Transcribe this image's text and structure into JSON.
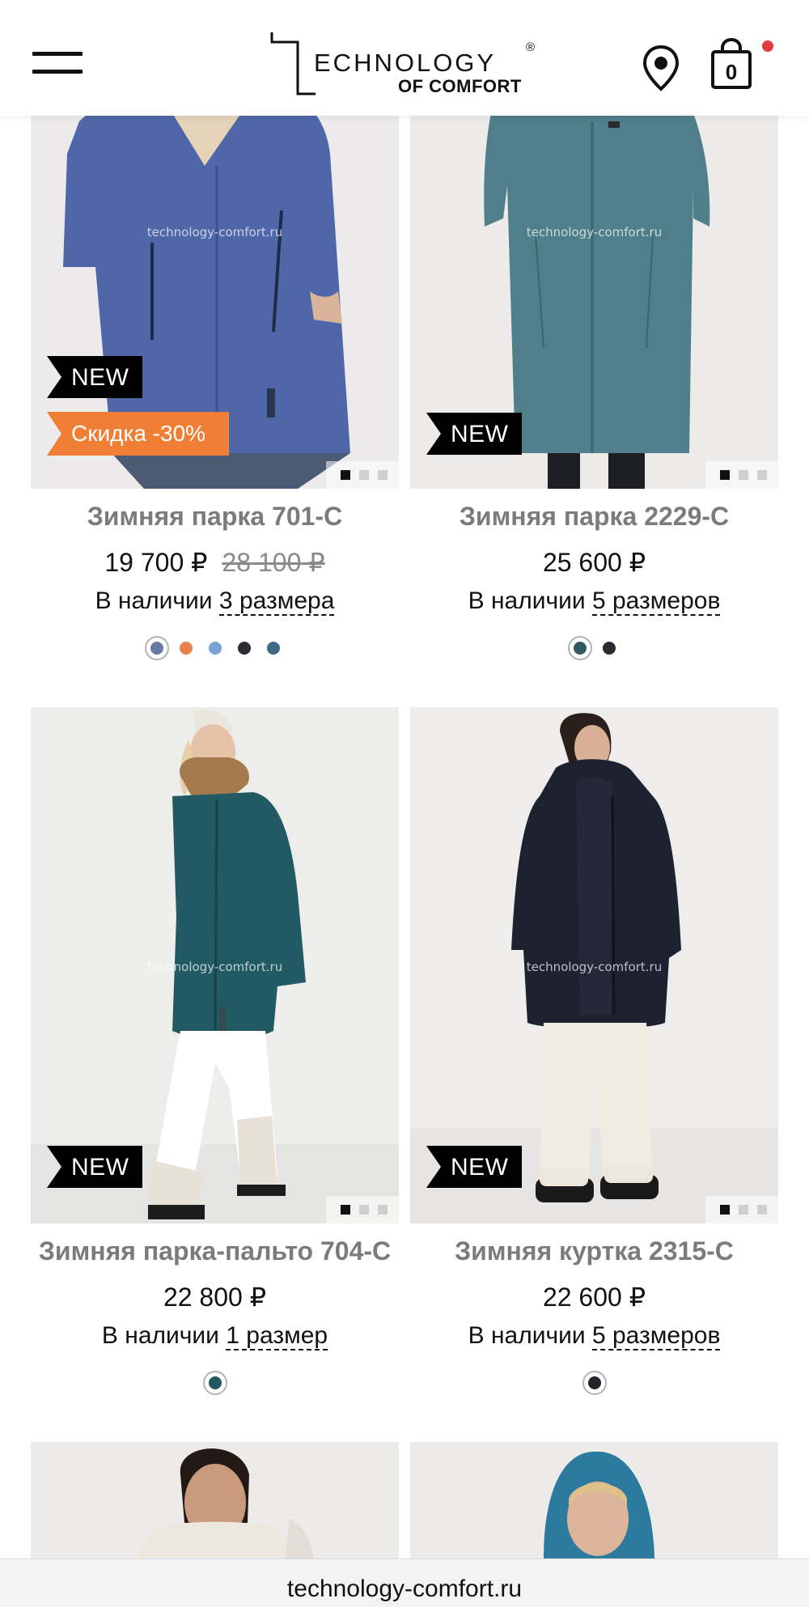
{
  "header": {
    "logo_main": "ECHNOLOGY",
    "logo_reg": "®",
    "logo_sub": "OF COMFORT",
    "cart_count": "0"
  },
  "products": [
    {
      "title": "Зимняя парка 701-С",
      "price": "19 700 ₽",
      "old_price": "28 100 ₽",
      "avail_prefix": "В наличии",
      "avail_sizes": "3 размера",
      "badge_new": "NEW",
      "badge_sale": "Скидка -30%",
      "watermark": "technology-comfort.ru",
      "slide_active": 1,
      "slide_total": 3,
      "colors": [
        "#6a78a6",
        "#e8804c",
        "#7aa2d4",
        "#2b2b33",
        "#3e6a85"
      ],
      "selected_color": 0
    },
    {
      "title": "Зимняя парка 2229-С",
      "price": "25 600 ₽",
      "avail_prefix": "В наличии",
      "avail_sizes": "5 размеров",
      "badge_new": "NEW",
      "watermark": "technology-comfort.ru",
      "slide_active": 1,
      "slide_total": 3,
      "colors": [
        "#2f5a63",
        "#2a2b30"
      ],
      "selected_color": 0
    },
    {
      "title": "Зимняя парка-пальто 704-С",
      "price": "22 800 ₽",
      "avail_prefix": "В наличии",
      "avail_sizes": "1 размер",
      "badge_new": "NEW",
      "watermark": "technology-comfort.ru",
      "slide_active": 1,
      "slide_total": 3,
      "colors": [
        "#245660"
      ],
      "selected_color": 0
    },
    {
      "title": "Зимняя куртка 2315-С",
      "price": "22 600 ₽",
      "avail_prefix": "В наличии",
      "avail_sizes": "5 размеров",
      "badge_new": "NEW",
      "watermark": "technology-comfort.ru",
      "slide_active": 1,
      "slide_total": 3,
      "colors": [
        "#23242b"
      ],
      "selected_color": 0
    }
  ],
  "browser": {
    "url": "technology-comfort.ru"
  }
}
